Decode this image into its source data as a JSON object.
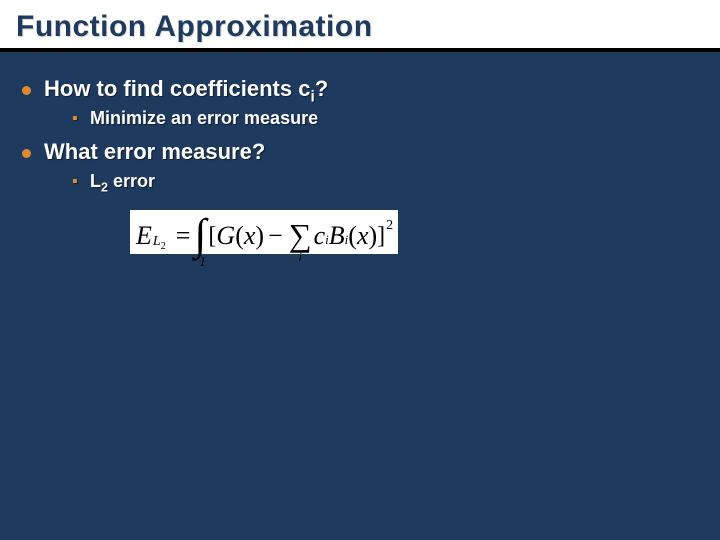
{
  "title": "Function Approximation",
  "bullets": {
    "b1": {
      "pre": "How to find coefficients c",
      "sub": "i",
      "post": "?"
    },
    "b1s1": "Minimize an error measure",
    "b2": "What error measure?",
    "b2s1": {
      "pre": "L",
      "sub": "2",
      "post": " error"
    }
  },
  "formula": {
    "E": "E",
    "Lsub": "L",
    "Ltwo": "2",
    "eq": "=",
    "intLow": "I",
    "lbr": "[",
    "G": "G",
    "open": "(",
    "x": "x",
    "close": ")",
    "minus": "−",
    "c": "c",
    "isub": "i",
    "B": "B",
    "rbr": "]",
    "sq": "2"
  }
}
